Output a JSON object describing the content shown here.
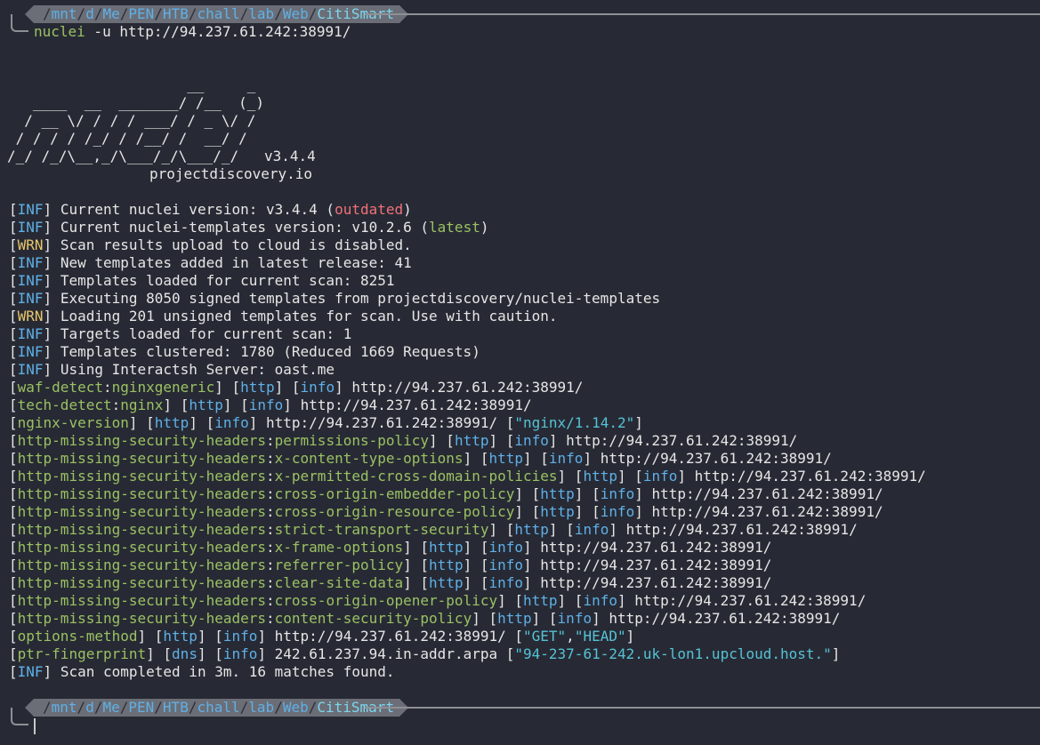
{
  "prompt1": {
    "path_parts": [
      "mnt",
      "d",
      "Me",
      "PEN",
      "HTB",
      "chall",
      "lab",
      "Web"
    ],
    "path_last": "CitiSmart",
    "cmd_name": "nuclei",
    "cmd_args": " -u http://94.237.61.242:38991/"
  },
  "banner": {
    "art": [
      "                     __     _",
      "   ____  __  _______/ /__  (_)",
      "  / __ \\/ / / / ___/ / _ \\/ /",
      " / / / / /_/ / /__/ /  __/ /",
      "/_/ /_/\\__,_/\\___/_/\\___/_/   v3.4.4"
    ],
    "site": "projectdiscovery.io"
  },
  "logs": [
    {
      "level": "INF",
      "text": "Current nuclei version: v3.4.4 (",
      "tag": "outdated",
      "tag_color": "red",
      "end": ")"
    },
    {
      "level": "INF",
      "text": "Current nuclei-templates version: v10.2.6 (",
      "tag": "latest",
      "tag_color": "green",
      "end": ")"
    },
    {
      "level": "WRN",
      "text": "Scan results upload to cloud is disabled."
    },
    {
      "level": "INF",
      "text": "New templates added in latest release: 41"
    },
    {
      "level": "INF",
      "text": "Templates loaded for current scan: 8251"
    },
    {
      "level": "INF",
      "text": "Executing 8050 signed templates from projectdiscovery/nuclei-templates"
    },
    {
      "level": "WRN",
      "text": "Loading 201 unsigned templates for scan. Use with caution."
    },
    {
      "level": "INF",
      "text": "Targets loaded for current scan: 1"
    },
    {
      "level": "INF",
      "text": "Templates clustered: 1780 (Reduced 1669 Requests)"
    },
    {
      "level": "INF",
      "text": "Using Interactsh Server: oast.me"
    }
  ],
  "findings": [
    {
      "template": "waf-detect",
      "matcher": "nginxgeneric",
      "proto": "http",
      "sev": "info",
      "url": "http://94.237.61.242:38991/"
    },
    {
      "template": "tech-detect",
      "matcher": "nginx",
      "proto": "http",
      "sev": "info",
      "url": "http://94.237.61.242:38991/"
    },
    {
      "template": "nginx-version",
      "proto": "http",
      "sev": "info",
      "url": "http://94.237.61.242:38991/",
      "extra": [
        "nginx/1.14.2"
      ]
    },
    {
      "template": "http-missing-security-headers",
      "matcher": "permissions-policy",
      "proto": "http",
      "sev": "info",
      "url": "http://94.237.61.242:38991/"
    },
    {
      "template": "http-missing-security-headers",
      "matcher": "x-content-type-options",
      "proto": "http",
      "sev": "info",
      "url": "http://94.237.61.242:38991/"
    },
    {
      "template": "http-missing-security-headers",
      "matcher": "x-permitted-cross-domain-policies",
      "proto": "http",
      "sev": "info",
      "url": "http://94.237.61.242:38991/"
    },
    {
      "template": "http-missing-security-headers",
      "matcher": "cross-origin-embedder-policy",
      "proto": "http",
      "sev": "info",
      "url": "http://94.237.61.242:38991/"
    },
    {
      "template": "http-missing-security-headers",
      "matcher": "cross-origin-resource-policy",
      "proto": "http",
      "sev": "info",
      "url": "http://94.237.61.242:38991/"
    },
    {
      "template": "http-missing-security-headers",
      "matcher": "strict-transport-security",
      "proto": "http",
      "sev": "info",
      "url": "http://94.237.61.242:38991/"
    },
    {
      "template": "http-missing-security-headers",
      "matcher": "x-frame-options",
      "proto": "http",
      "sev": "info",
      "url": "http://94.237.61.242:38991/"
    },
    {
      "template": "http-missing-security-headers",
      "matcher": "referrer-policy",
      "proto": "http",
      "sev": "info",
      "url": "http://94.237.61.242:38991/"
    },
    {
      "template": "http-missing-security-headers",
      "matcher": "clear-site-data",
      "proto": "http",
      "sev": "info",
      "url": "http://94.237.61.242:38991/"
    },
    {
      "template": "http-missing-security-headers",
      "matcher": "cross-origin-opener-policy",
      "proto": "http",
      "sev": "info",
      "url": "http://94.237.61.242:38991/"
    },
    {
      "template": "http-missing-security-headers",
      "matcher": "content-security-policy",
      "proto": "http",
      "sev": "info",
      "url": "http://94.237.61.242:38991/"
    },
    {
      "template": "options-method",
      "proto": "http",
      "sev": "info",
      "url": "http://94.237.61.242:38991/",
      "extra": [
        "GET",
        "HEAD"
      ]
    },
    {
      "template": "ptr-fingerprint",
      "proto": "dns",
      "sev": "info",
      "url": "242.61.237.94.in-addr.arpa",
      "extra": [
        "94-237-61-242.uk-lon1.upcloud.host."
      ]
    }
  ],
  "final": {
    "level": "INF",
    "text": "Scan completed in 3m. 16 matches found."
  },
  "prompt2": {
    "path_parts": [
      "mnt",
      "d",
      "Me",
      "PEN",
      "HTB",
      "chall",
      "lab",
      "Web"
    ],
    "path_last": "CitiSmart"
  },
  "colors": {
    "background": "#272a34",
    "level_inf": "#5fb0e8",
    "level_wrn": "#e8c66b",
    "template": "#9bc163",
    "matcher": "#9bc163",
    "outdated": "#f2707a",
    "extracted": "#56c2d6"
  }
}
